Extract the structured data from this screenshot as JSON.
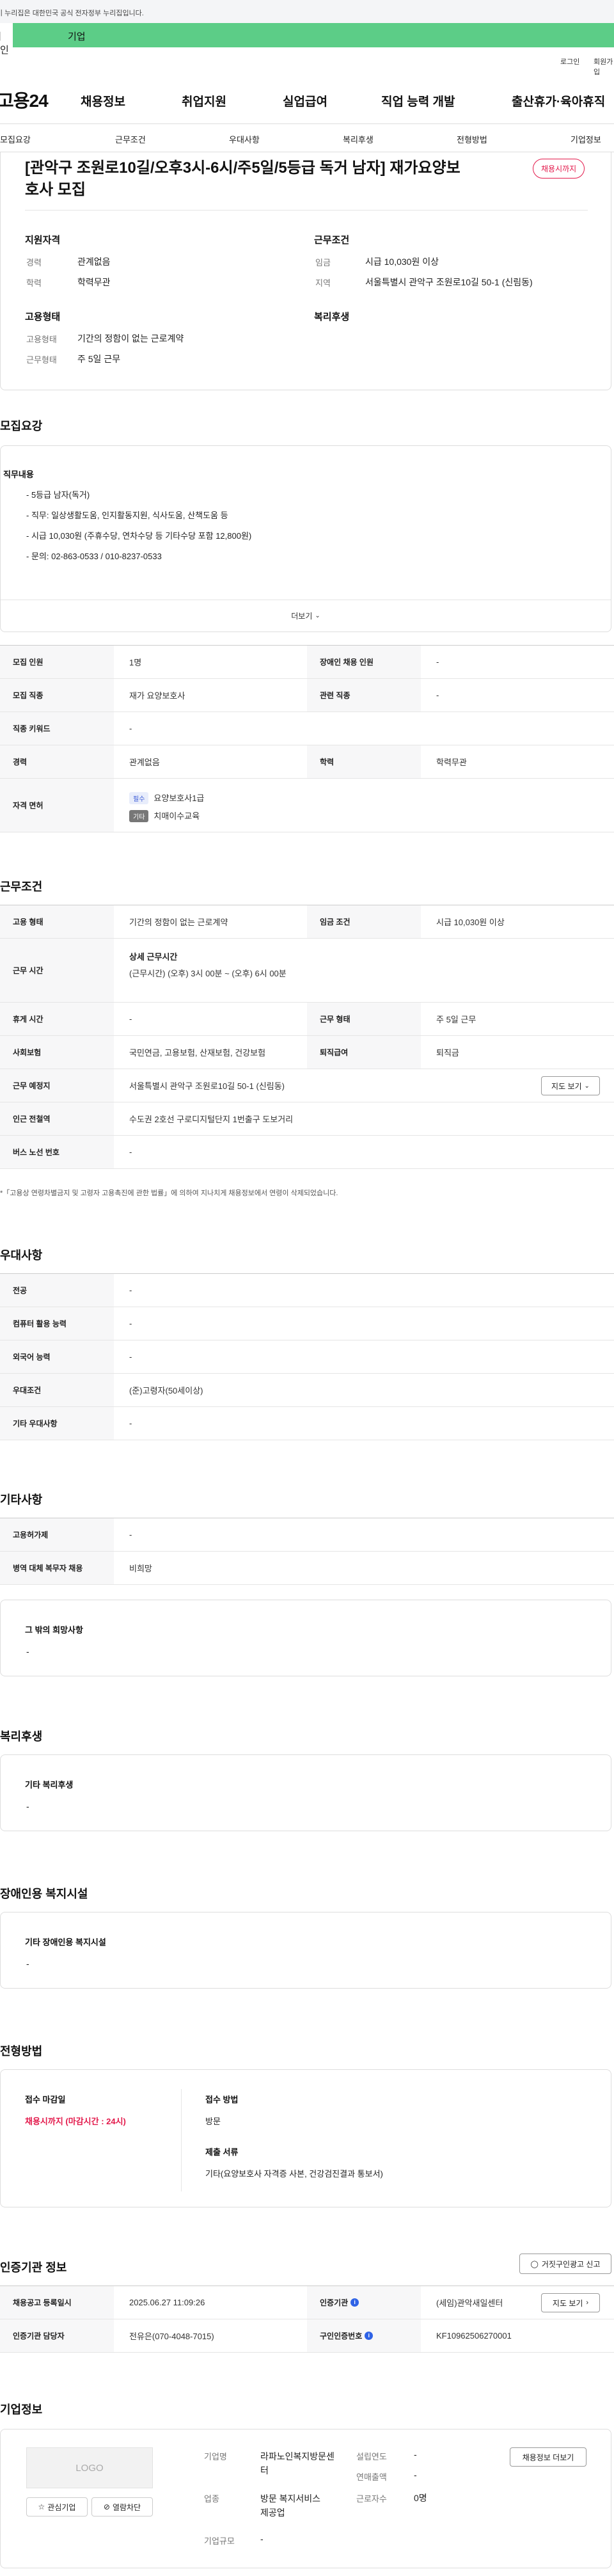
{
  "notice": "이 누리집은 대한민국 공식 전자정부 누리집입니다.",
  "tabs": {
    "individual": "개인",
    "company": "기업"
  },
  "util": {
    "login": "로그인",
    "signup": "회원가입"
  },
  "logo": "고용24",
  "gnb": [
    "채용정보",
    "취업지원",
    "실업급여",
    "직업 능력 개발",
    "출산휴가·육아휴직"
  ],
  "subnav": [
    "모집요강",
    "근무조건",
    "우대사항",
    "복리후생",
    "전형방법",
    "기업정보"
  ],
  "summary": {
    "title": "[관악구 조원로10길/오후3시-6시/주5일/5등급 독거 남자] 재가요양보호사 모집",
    "badge": "채용시까지",
    "qual_heading": "지원자격",
    "career_label": "경력",
    "career_value": "관계없음",
    "edu_label": "학력",
    "edu_value": "학력무관",
    "work_heading": "근무조건",
    "wage_label": "임금",
    "wage_value": "시급 10,030원 이상",
    "region_label": "지역",
    "region_value": "서울특별시 관악구 조원로10길 50-1 (신림동)",
    "emp_heading": "고용형태",
    "emptype_label": "고용형태",
    "emptype_value": "기간의 정함이 없는 근로계약",
    "worktype_label": "근무형태",
    "worktype_value": "주 5일 근무",
    "welfare_heading": "복리후생"
  },
  "recruit": {
    "heading": "모집요강",
    "duty_heading": "직무내용",
    "duties": [
      "- 5등급 남자(독거)",
      "- 직무:  일상생활도움, 인지활동지원, 식사도움, 산책도움 등",
      "- 시급 10,030원 (주휴수당, 연차수당 등 기타수당 포함 12,800원)",
      "- 문의: 02-863-0533 / 010-8237-0533"
    ],
    "more": "더보기",
    "rows": {
      "headcount_label": "모집 인원",
      "headcount_value": "1명",
      "disabled_label": "장애인 채용 인원",
      "disabled_value": "-",
      "job_label": "모집 직종",
      "job_value": "재가 요양보호사",
      "related_label": "관련 직종",
      "related_value": "-",
      "keyword_label": "직종 키워드",
      "keyword_value": "-",
      "career_label": "경력",
      "career_value": "관계없음",
      "edu_label": "학력",
      "edu_value": "학력무관",
      "license_label": "자격 면허",
      "license_chip1": "필수",
      "license_value1": "요양보호사1급",
      "license_chip2": "기타",
      "license_value2": "치매이수교육"
    }
  },
  "work": {
    "heading": "근무조건",
    "emptype_label": "고용 형태",
    "emptype_value": "기간의 정함이 없는 근로계약",
    "wage_label": "임금 조건",
    "wage_value": "시급 10,030원 이상",
    "hours_label": "근무 시간",
    "hours_title": "상세 근무시간",
    "hours_value": "(근무시간) (오후) 3시 00분 ~ (오후) 6시 00분",
    "rest_label": "휴게 시간",
    "rest_value": "-",
    "form_label": "근무 형태",
    "form_value": "주 5일 근무",
    "insurance_label": "사회보험",
    "insurance_value": "국민연금, 고용보험, 산재보험, 건강보험",
    "severance_label": "퇴직급여",
    "severance_value": "퇴직금",
    "place_label": "근무 예정지",
    "place_value": "서울특별시 관악구 조원로10길 50-1 (신림동)",
    "map_btn": "지도 보기",
    "station_label": "인근 전철역",
    "station_value": "수도권 2호선 구로디지털단지 1번출구 도보거리",
    "bus_label": "버스 노선 번호",
    "bus_value": "-",
    "footnote": "*「고용상 연령차별금지 및 고령자 고용촉진에 관한 법률」에 의하여 지나치게 채용정보에서 연령이 삭제되었습니다."
  },
  "pref": {
    "heading": "우대사항",
    "major_label": "전공",
    "major_value": "-",
    "pc_label": "컴퓨터 활용 능력",
    "pc_value": "-",
    "lang_label": "외국어 능력",
    "lang_value": "-",
    "cond_label": "우대조건",
    "cond_value": "(준)고령자(50세이상)",
    "etc_label": "기타 우대사항",
    "etc_value": "-"
  },
  "other": {
    "heading": "기타사항",
    "permit_label": "고용허가제",
    "permit_value": "-",
    "military_label": "병역 대체 복무자 채용",
    "military_value": "비희망",
    "wish_heading": "그 밖의 희망사항",
    "wish_value": "-"
  },
  "welfare": {
    "heading": "복리후생",
    "sub": "기타 복리후생",
    "value": "-"
  },
  "facility": {
    "heading": "장애인용 복지시설",
    "sub": "기타 장애인용 복지시설",
    "value": "-"
  },
  "selection": {
    "heading": "전형방법",
    "deadline_label": "접수 마감일",
    "deadline_value": "채용시까지 (마감시간 : 24시)",
    "method_label": "접수 방법",
    "method_value": "방문",
    "docs_label": "제출 서류",
    "docs_value": "기타(요양보호사 자격증 사본, 건강검진결과 통보서)"
  },
  "agency": {
    "heading": "인증기관 정보",
    "report_btn": "거짓구인광고 신고",
    "regdate_label": "채용공고 등록일시",
    "regdate_value": "2025.06.27 11:09:26",
    "agency_label": "인증기관",
    "agency_value": "(세임)관악새일센터",
    "map_btn": "지도 보기",
    "manager_label": "인증기관 담당자",
    "manager_value": "전유은(070-4048-7015)",
    "number_label": "구인인증번호",
    "number_value": "KF10962506270001"
  },
  "company": {
    "heading": "기업정보",
    "logo_text": "LOGO",
    "fav_btn": "관심기업",
    "block_btn": "열람차단",
    "name_label": "기업명",
    "name_value": "라파노인복지방문센터",
    "founded_label": "설립연도",
    "founded_value": "-",
    "sales_label": "연매출액",
    "sales_value": "-",
    "industry_label": "업종",
    "industry_value": "방문 복지서비스 제공업",
    "staff_label": "근로자수",
    "staff_value": "0명",
    "scale_label": "기업규모",
    "scale_value": "-",
    "more_btn": "채용정보 더보기"
  }
}
